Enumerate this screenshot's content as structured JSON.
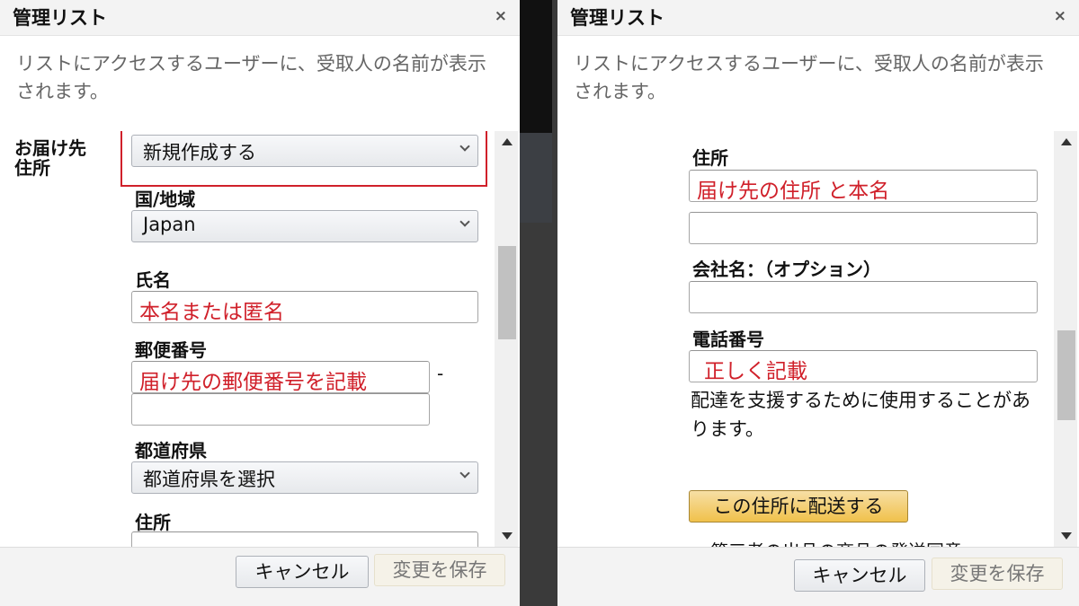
{
  "left": {
    "title": "管理リスト",
    "close": "×",
    "intro": "リストにアクセスするユーザーに、受取人の名前が表示されます。",
    "shipping_label": "お届け先 住所",
    "address_select": "新規作成する",
    "country_label": "国/地域",
    "country_select": "Japan",
    "name_label": "氏名",
    "name_value": "本名または匿名",
    "postal_label": "郵便番号",
    "postal_value": "届け先の郵便番号を記載",
    "postal_dash": "-",
    "postal_value2": "",
    "pref_label": "都道府県",
    "pref_select": "都道府県を選択",
    "address_label": "住所",
    "cancel": "キャンセル",
    "save": "変更を保存"
  },
  "right": {
    "title": "管理リスト",
    "close": "×",
    "intro": "リストにアクセスするユーザーに、受取人の名前が表示されます。",
    "address_label": "住所",
    "address_value": "届け先の住所 と本名",
    "address_value2": "",
    "company_label": "会社名：（オプション）",
    "company_value": "",
    "phone_label": "電話番号",
    "phone_value": "正しく記載",
    "phone_helper": "配達を支援するために使用することがあります。",
    "ship_button": "この住所に配送する",
    "consent_text": "第三者の出品の商品の発送同意",
    "cancel": "キャンセル",
    "save": "変更を保存"
  },
  "colors": {
    "annotation_red": "#d0202a",
    "primary_button": "#f0c14b"
  }
}
